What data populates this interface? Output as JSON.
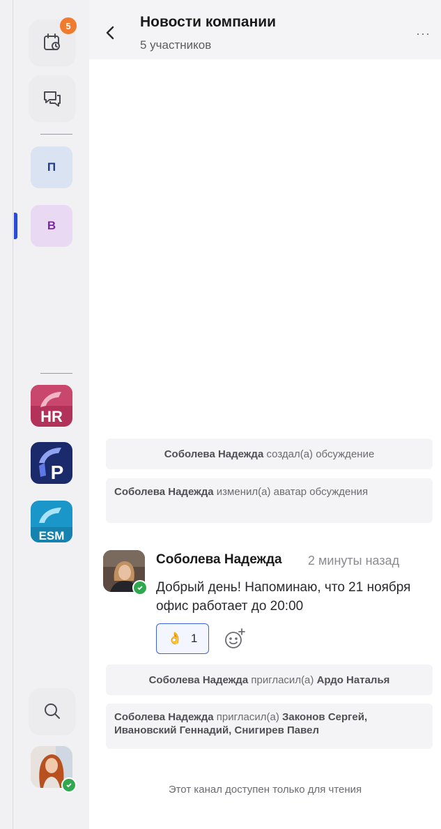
{
  "rail": {
    "badge_count": "5",
    "items": [
      {
        "letter": "П",
        "bg": "#d9e3f1",
        "color": "#1e3a8a"
      },
      {
        "letter": "В",
        "bg": "#ead9f3",
        "color": "#7b2a9b"
      }
    ],
    "apps": [
      {
        "name": "HR",
        "bg": "#b2325a"
      },
      {
        "name": "P",
        "bg": "#1b2a6b"
      },
      {
        "name": "ESM",
        "bg": "#1a96c8"
      }
    ]
  },
  "header": {
    "title": "Новости компании",
    "subtitle": "5 участников",
    "more": "···"
  },
  "system_messages": [
    {
      "actor": "Соболева Надежда",
      "text": " создал(а) обсуждение",
      "target": ""
    },
    {
      "actor": "Соболева Надежда",
      "text": " изменил(а) аватар обсуждения",
      "target": ""
    },
    {
      "actor": "Соболева Надежда",
      "text": " пригласил(а) ",
      "target": "Ардо Наталья"
    },
    {
      "actor": "Соболева Надежда",
      "text": " пригласил(а) ",
      "target": "Законов Сергей, Ивановский Геннадий, Снигирев Павел"
    }
  ],
  "message": {
    "author": "Соболева Надежда",
    "time": "2 минуты назад",
    "text": "Добрый день! Напоминаю, что 21 ноября офис работает до 20:00",
    "reaction_emoji": "👌",
    "reaction_count": "1"
  },
  "footer": {
    "readonly": "Этот канал доступен только для чтения"
  }
}
